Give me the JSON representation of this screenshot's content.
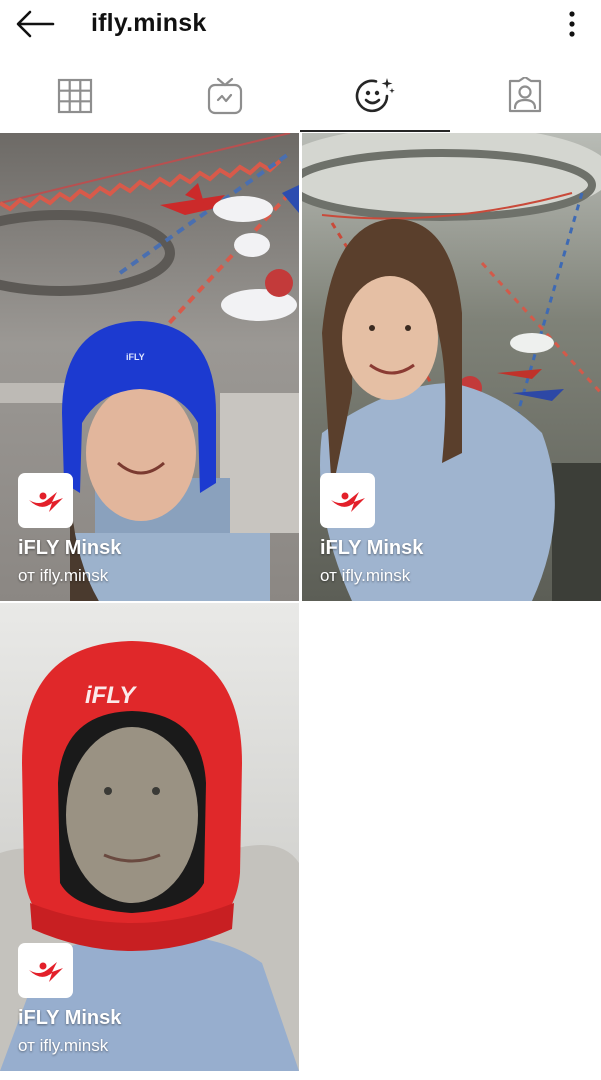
{
  "header": {
    "title": "ifly.minsk",
    "back_icon": "arrow-left-icon",
    "more_icon": "more-vertical-icon"
  },
  "tabs": [
    {
      "name": "grid",
      "icon": "grid-icon",
      "active": false
    },
    {
      "name": "igtv",
      "icon": "tv-icon",
      "active": false
    },
    {
      "name": "effects",
      "icon": "face-effects-icon",
      "active": true
    },
    {
      "name": "tagged",
      "icon": "tagged-person-icon",
      "active": false
    }
  ],
  "effects": [
    {
      "name": "iFLY Minsk",
      "author": "от ifly.minsk",
      "helmet_color": "#1f3fc9",
      "logo_icon": "ifly-logo-icon"
    },
    {
      "name": "iFLY Minsk",
      "author": "от ifly.minsk",
      "helmet_color": "none",
      "logo_icon": "ifly-logo-icon"
    },
    {
      "name": "iFLY Minsk",
      "author": "от ifly.minsk",
      "helmet_color": "#e0282a",
      "logo_icon": "ifly-logo-icon"
    }
  ],
  "colors": {
    "text": "#111111",
    "tab_icon": "#8e8e8e",
    "active_tab_icon": "#262626",
    "logo_red": "#e3202a"
  }
}
